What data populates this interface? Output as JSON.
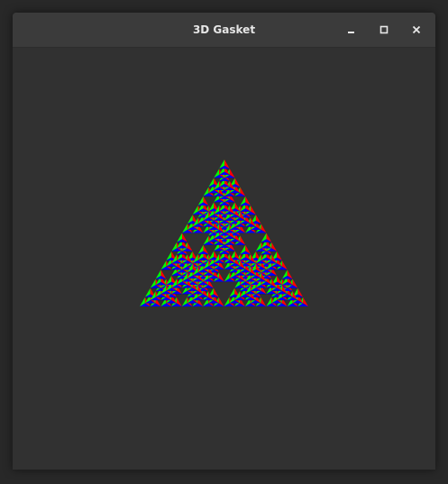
{
  "window": {
    "title": "3D Gasket"
  },
  "controls": {
    "minimize_icon": "minimize-icon",
    "maximize_icon": "maximize-icon",
    "close_icon": "close-icon"
  },
  "canvas": {
    "background": "#313131",
    "subdivisions": 4,
    "face_colors": {
      "left": "#00ff00",
      "right": "#ff0000",
      "front": "#0000ff",
      "bottom": "#000000"
    }
  }
}
